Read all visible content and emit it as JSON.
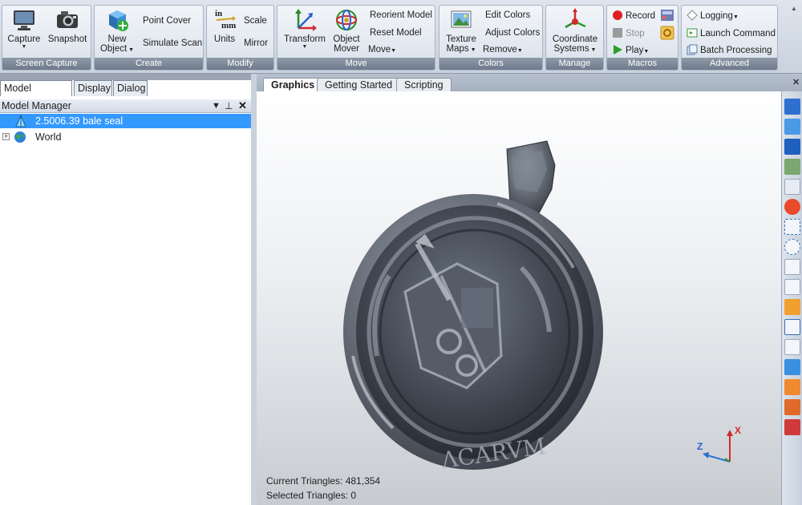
{
  "ribbon": {
    "groups": {
      "screen_capture": "Screen Capture",
      "create": "Create",
      "modify": "Modify",
      "move": "Move",
      "colors": "Colors",
      "manage": "Manage",
      "macros": "Macros",
      "advanced": "Advanced"
    },
    "capture": "Capture",
    "snapshot": "Snapshot",
    "new_object_1": "New",
    "new_object_2": "Object",
    "point_cover": "Point Cover",
    "simulate_scan": "Simulate Scan",
    "units_in": "in",
    "units_mm": "mm",
    "units": "Units",
    "scale": "Scale",
    "mirror": "Mirror",
    "transform": "Transform",
    "object_mover_1": "Object",
    "object_mover_2": "Mover",
    "reorient_model": "Reorient Model",
    "reset_model": "Reset Model",
    "move": "Move",
    "texture_maps_1": "Texture",
    "texture_maps_2": "Maps",
    "edit_colors": "Edit Colors",
    "adjust_colors": "Adjust Colors",
    "remove": "Remove",
    "coord_systems_1": "Coordinate",
    "coord_systems_2": "Systems",
    "record": "Record",
    "stop": "Stop",
    "play": "Play",
    "logging": "Logging",
    "launch_command": "Launch Command",
    "batch_processing": "Batch Processing"
  },
  "left_tabs": [
    "Model Manager",
    "Display",
    "Dialog"
  ],
  "model_manager": {
    "title": "Model Manager",
    "items": [
      {
        "label": "2.5006.39 bale seal"
      },
      {
        "label": "World"
      }
    ]
  },
  "doc_tabs": [
    "Graphics",
    "Getting Started",
    "Scripting"
  ],
  "viewport": {
    "current_triangles": "Current Triangles: 481,354",
    "selected_triangles": "Selected Triangles: 0",
    "axis_z": "Z",
    "axis_x": "X"
  },
  "colors": {
    "selection": "#3399ff",
    "ribbon_label": "#7a8596",
    "record_red": "#e02020",
    "play_green": "#2aa02a"
  }
}
